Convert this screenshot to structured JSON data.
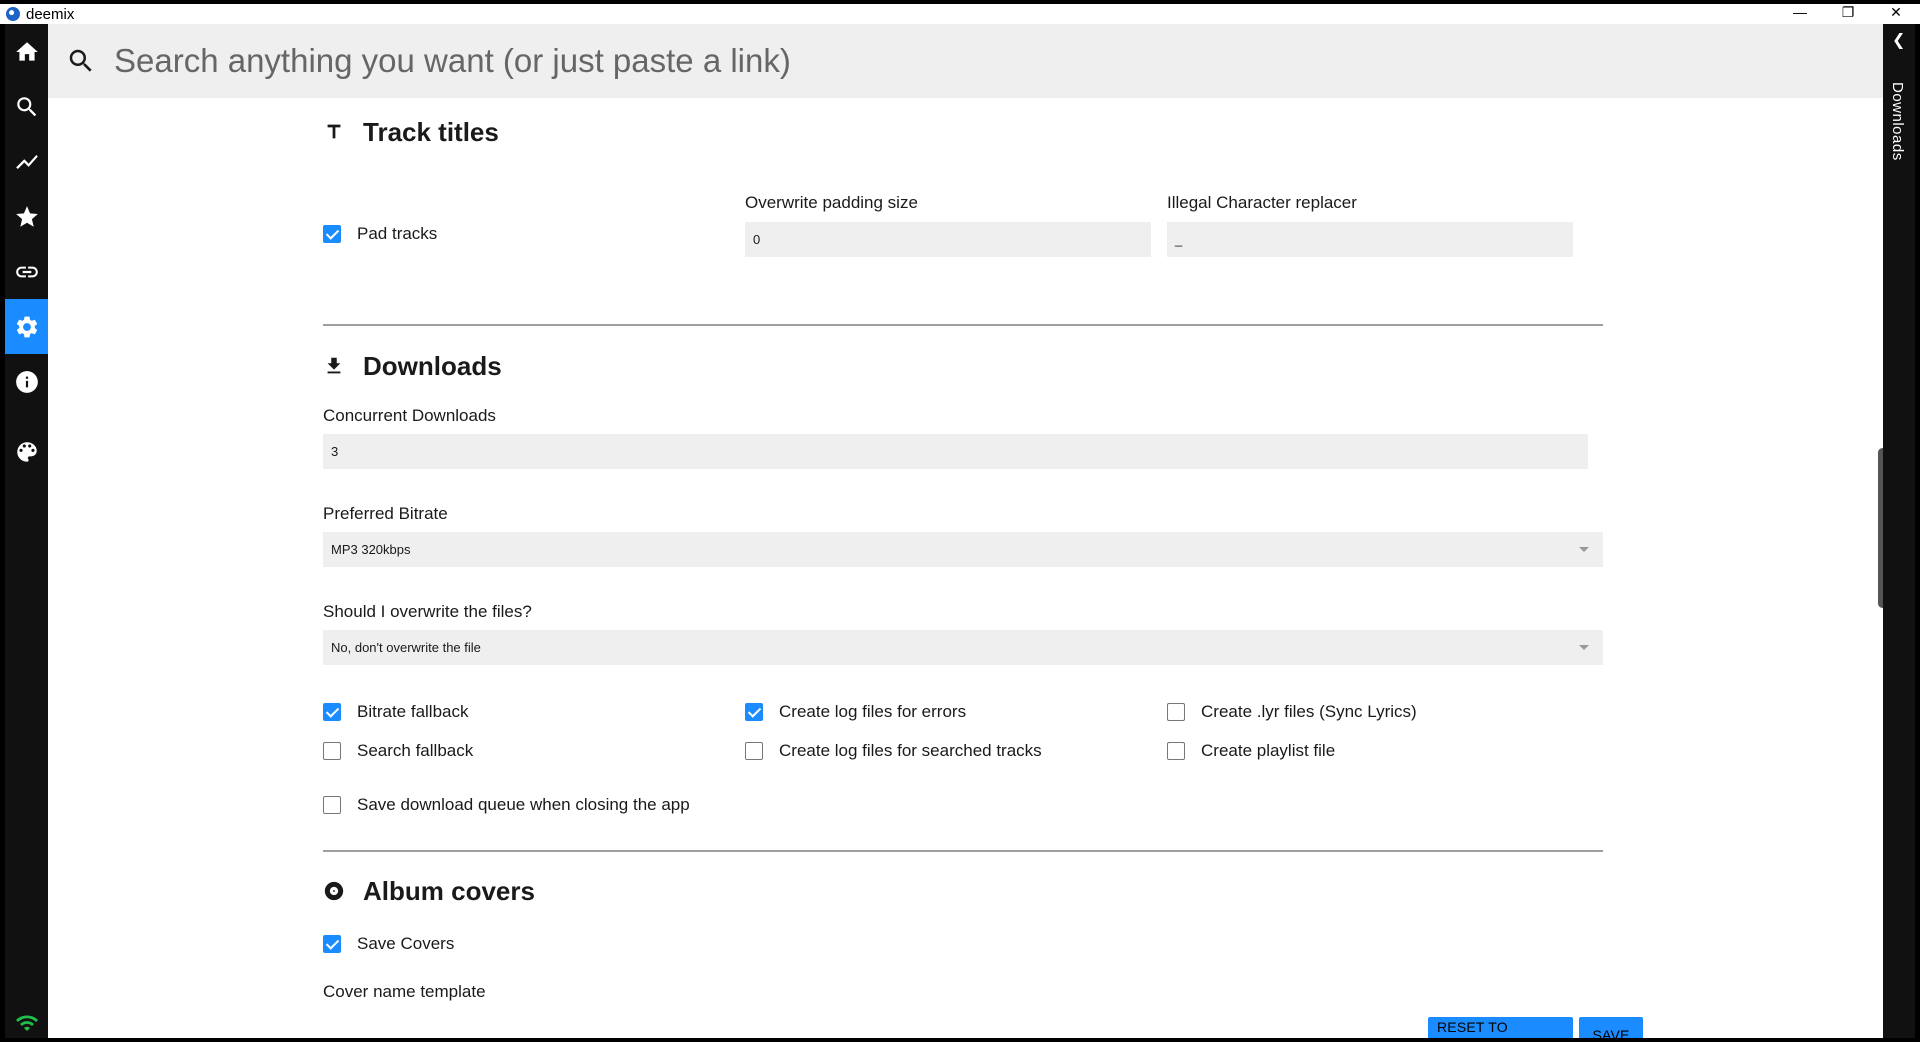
{
  "window": {
    "title": "deemix",
    "minimize_glyph": "—",
    "maximize_glyph": "❐",
    "close_glyph": "✕"
  },
  "sidebar": {
    "items": [
      {
        "name": "home",
        "icon": "home-icon",
        "active": false
      },
      {
        "name": "search",
        "icon": "search-icon",
        "active": false
      },
      {
        "name": "charts",
        "icon": "trending-icon",
        "active": false
      },
      {
        "name": "favorites",
        "icon": "star-icon",
        "active": false
      },
      {
        "name": "link-analyzer",
        "icon": "link-icon",
        "active": false
      },
      {
        "name": "settings",
        "icon": "gear-icon",
        "active": true
      },
      {
        "name": "about",
        "icon": "info-icon",
        "active": false
      },
      {
        "name": "theme",
        "icon": "palette-icon",
        "active": false
      }
    ],
    "status_icon": "wifi-icon"
  },
  "downloads_bar": {
    "label": "Downloads",
    "toggle_glyph": "❮"
  },
  "search": {
    "placeholder": "Search anything you want (or just paste a link)",
    "value": ""
  },
  "track_titles": {
    "title": "Track titles",
    "icon": "text-t-icon",
    "pad_tracks_label": "Pad tracks",
    "pad_tracks_checked": true,
    "padding_size_label": "Overwrite padding size",
    "padding_size_value": "0",
    "illegal_char_label": "Illegal Character replacer",
    "illegal_char_value": "_"
  },
  "downloads": {
    "title": "Downloads",
    "icon": "download-icon",
    "concurrent_label": "Concurrent Downloads",
    "concurrent_value": "3",
    "bitrate_label": "Preferred Bitrate",
    "bitrate_value": "MP3 320kbps",
    "overwrite_label": "Should I overwrite the files?",
    "overwrite_value": "No, don't overwrite the file",
    "checkboxes": {
      "bitrate_fallback": {
        "label": "Bitrate fallback",
        "checked": true
      },
      "log_errors": {
        "label": "Create log files for errors",
        "checked": true
      },
      "lyr_files": {
        "label": "Create .lyr files (Sync Lyrics)",
        "checked": false
      },
      "search_fallback": {
        "label": "Search fallback",
        "checked": false
      },
      "log_searched": {
        "label": "Create log files for searched tracks",
        "checked": false
      },
      "playlist_file": {
        "label": "Create playlist file",
        "checked": false
      },
      "save_queue": {
        "label": "Save download queue when closing the app",
        "checked": false
      }
    }
  },
  "album_covers": {
    "title": "Album covers",
    "icon": "album-icon",
    "save_covers_label": "Save Covers",
    "save_covers_checked": true,
    "cover_template_label": "Cover name template"
  },
  "actions": {
    "reset_label": "RESET TO DEFAULT",
    "save_label": "SAVE"
  },
  "colors": {
    "accent": "#1a8cff",
    "sidebar_bg": "#111111",
    "field_bg": "#efefef",
    "status_green": "#20c04a"
  }
}
